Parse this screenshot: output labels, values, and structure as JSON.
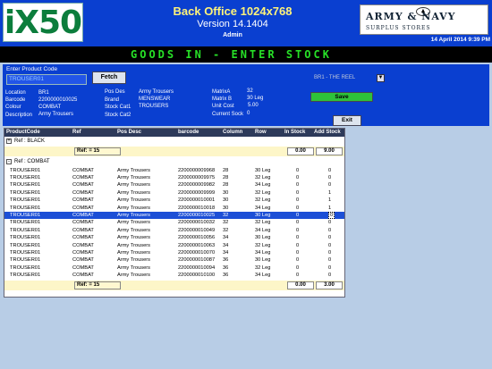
{
  "header": {
    "logo": "iX50",
    "title": "Back Office 1024x768",
    "version": "Version 14.1404",
    "user": "Admin",
    "brand_line1": "ARMY & NAVY",
    "brand_line2": "SURPLUS STORES",
    "datetime": "14 April 2014 9:39 PM"
  },
  "banner": "GOODS IN - ENTER STOCK",
  "entry": {
    "label": "Enter Product Code",
    "value": "TROUSER01",
    "fetch_label": "Fetch",
    "branch": "BR1 - THE REEL",
    "dropdown_icon": "▼"
  },
  "details": {
    "location_label": "Location",
    "location": "BR1",
    "barcode_label": "Barcode",
    "barcode": "2200000010025",
    "colour_label": "Colour",
    "colour": "COMBAT",
    "description_label": "Description",
    "description": "Army Trousers",
    "posdes_label": "Pos Des",
    "posdes": "Army Trousers",
    "brand_label": "Brand",
    "brand": "MENSWEAR",
    "cat1_label": "Stock Cat1",
    "cat1": "TROUSERS",
    "cat2_label": "Stock Cat2",
    "cat2": "",
    "matrixa_label": "MatrixA",
    "matrixa": "32",
    "matrixb_label": "Matrix B",
    "matrixb": "30 Leg",
    "unitcost_label": "Unit Cost",
    "unitcost": "5.00",
    "curstock_label": "Current Sock",
    "curstock": "0",
    "save_label": "Save",
    "exit_label": "Exit"
  },
  "grid": {
    "columns": [
      "ProductCode",
      "Ref",
      "Pos Desc",
      "barcode",
      "Column",
      "Row",
      "In Stock",
      "Add Stock"
    ],
    "group1": {
      "toggle": "+",
      "label": "Ref : BLACK",
      "ref": "Ref: = 15",
      "in_stock": "0.00",
      "add_stock": "9.00"
    },
    "group2": {
      "toggle": "-",
      "label": "Ref : COMBAT",
      "ref": "Ref: = 15",
      "in_stock": "0.00",
      "add_stock": "3.00"
    },
    "rows": [
      [
        "TROUSER01",
        "COMBAT",
        "Army Trousers",
        "2200000009968",
        "28",
        "30 Leg",
        "0",
        "0"
      ],
      [
        "TROUSER01",
        "COMBAT",
        "Army Trousers",
        "2200000009975",
        "28",
        "32 Leg",
        "0",
        "0"
      ],
      [
        "TROUSER01",
        "COMBAT",
        "Army Trousers",
        "2200000009982",
        "28",
        "34 Leg",
        "0",
        "0"
      ],
      [
        "TROUSER01",
        "COMBAT",
        "Army Trousers",
        "2200000009999",
        "30",
        "32 Leg",
        "0",
        "1"
      ],
      [
        "TROUSER01",
        "COMBAT",
        "Army Trousers",
        "2200000010001",
        "30",
        "32 Leg",
        "0",
        "1"
      ],
      [
        "TROUSER01",
        "COMBAT",
        "Army Trousers",
        "2200000010018",
        "30",
        "34 Leg",
        "0",
        "1"
      ],
      [
        "TROUSER01",
        "COMBAT",
        "Army Trousers",
        "2200000010025",
        "32",
        "30 Leg",
        "0",
        "0"
      ],
      [
        "TROUSER01",
        "COMBAT",
        "Army Trousers",
        "2200000010032",
        "32",
        "32 Leg",
        "0",
        "0"
      ],
      [
        "TROUSER01",
        "COMBAT",
        "Army Trousers",
        "2200000010049",
        "32",
        "34 Leg",
        "0",
        "0"
      ],
      [
        "TROUSER01",
        "COMBAT",
        "Army Trousers",
        "2200000010056",
        "34",
        "30 Leg",
        "0",
        "0"
      ],
      [
        "TROUSER01",
        "COMBAT",
        "Army Trousers",
        "2200000010063",
        "34",
        "32 Leg",
        "0",
        "0"
      ],
      [
        "TROUSER01",
        "COMBAT",
        "Army Trousers",
        "2200000010070",
        "34",
        "34 Leg",
        "0",
        "0"
      ],
      [
        "TROUSER01",
        "COMBAT",
        "Army Trousers",
        "2200000010087",
        "36",
        "30 Leg",
        "0",
        "0"
      ],
      [
        "TROUSER01",
        "COMBAT",
        "Army Trousers",
        "2200000010094",
        "36",
        "32 Leg",
        "0",
        "0"
      ],
      [
        "TROUSER01",
        "COMBAT",
        "Army Trousers",
        "2200000010100",
        "36",
        "34 Leg",
        "0",
        "0"
      ]
    ],
    "selected_row": 6
  },
  "colors": {
    "panel": "#0a3fd0",
    "banner_text": "#27e027",
    "save": "#2ec23a",
    "selected": "#1c4fd6"
  }
}
